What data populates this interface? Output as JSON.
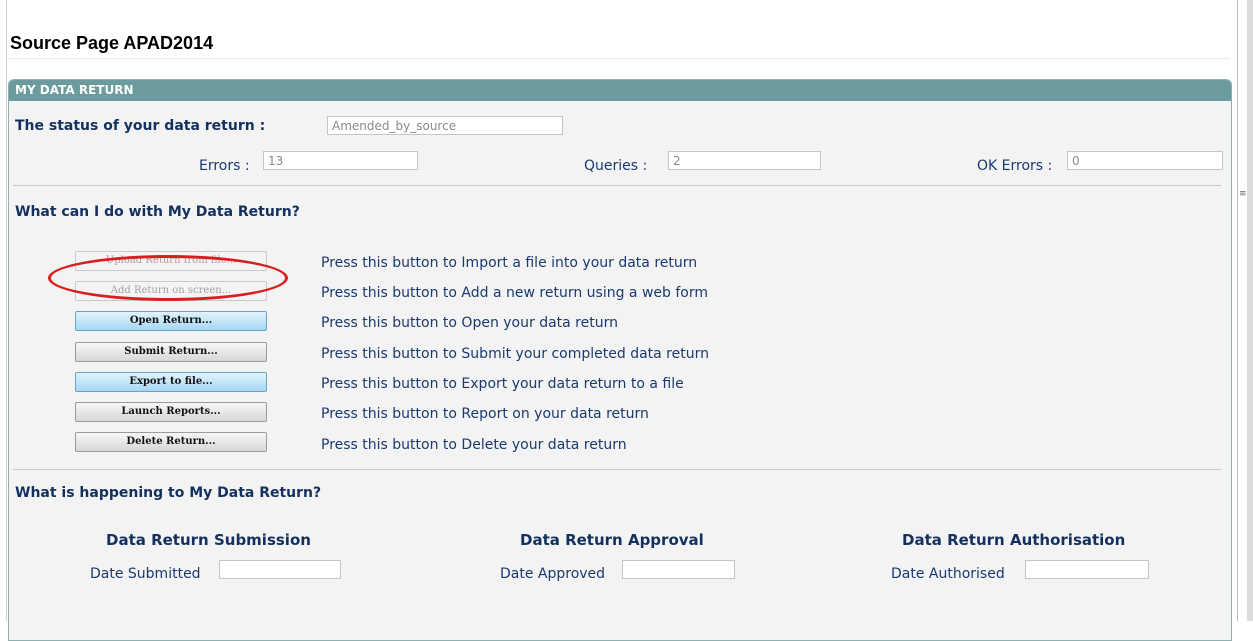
{
  "page": {
    "title": "Source Page APAD2014"
  },
  "panel": {
    "header": "MY DATA RETURN"
  },
  "status": {
    "label": "The status of your data return :",
    "value": "Amended_by_source",
    "errors_label": "Errors :",
    "errors_value": "13",
    "queries_label": "Queries :",
    "queries_value": "2",
    "ok_errors_label": "OK Errors :",
    "ok_errors_value": "0"
  },
  "actions": {
    "title": "What can I do with My Data Return?",
    "items": [
      {
        "button": "Upload Return from file...",
        "description": "Press this button to Import a file into your data return",
        "state": "disabled"
      },
      {
        "button": "Add Return on screen...",
        "description": "Press this button to Add a new return using a web form",
        "state": "disabled"
      },
      {
        "button": "Open Return...",
        "description": "Press this button to Open your data return",
        "state": "highlighted"
      },
      {
        "button": "Submit Return...",
        "description": "Press this button to Submit your completed data return",
        "state": "normal"
      },
      {
        "button": "Export to file...",
        "description": "Press this button to Export your data return to a file",
        "state": "highlighted"
      },
      {
        "button": "Launch Reports...",
        "description": "Press this button to Report on your data return",
        "state": "normal"
      },
      {
        "button": "Delete Return...",
        "description": "Press this button to Delete your data return",
        "state": "normal"
      }
    ]
  },
  "progress": {
    "title": "What is happening to My Data Return?",
    "submission": {
      "heading": "Data Return Submission",
      "label": "Date Submitted",
      "value": ""
    },
    "approval": {
      "heading": "Data Return Approval",
      "label": "Date Approved",
      "value": ""
    },
    "authorisation": {
      "heading": "Data Return Authorisation",
      "label": "Date Authorised",
      "value": ""
    }
  },
  "colors": {
    "panel_header": "#6b9b9d",
    "heading_text": "#14305f",
    "annotation_oval": "#d81e1e"
  }
}
